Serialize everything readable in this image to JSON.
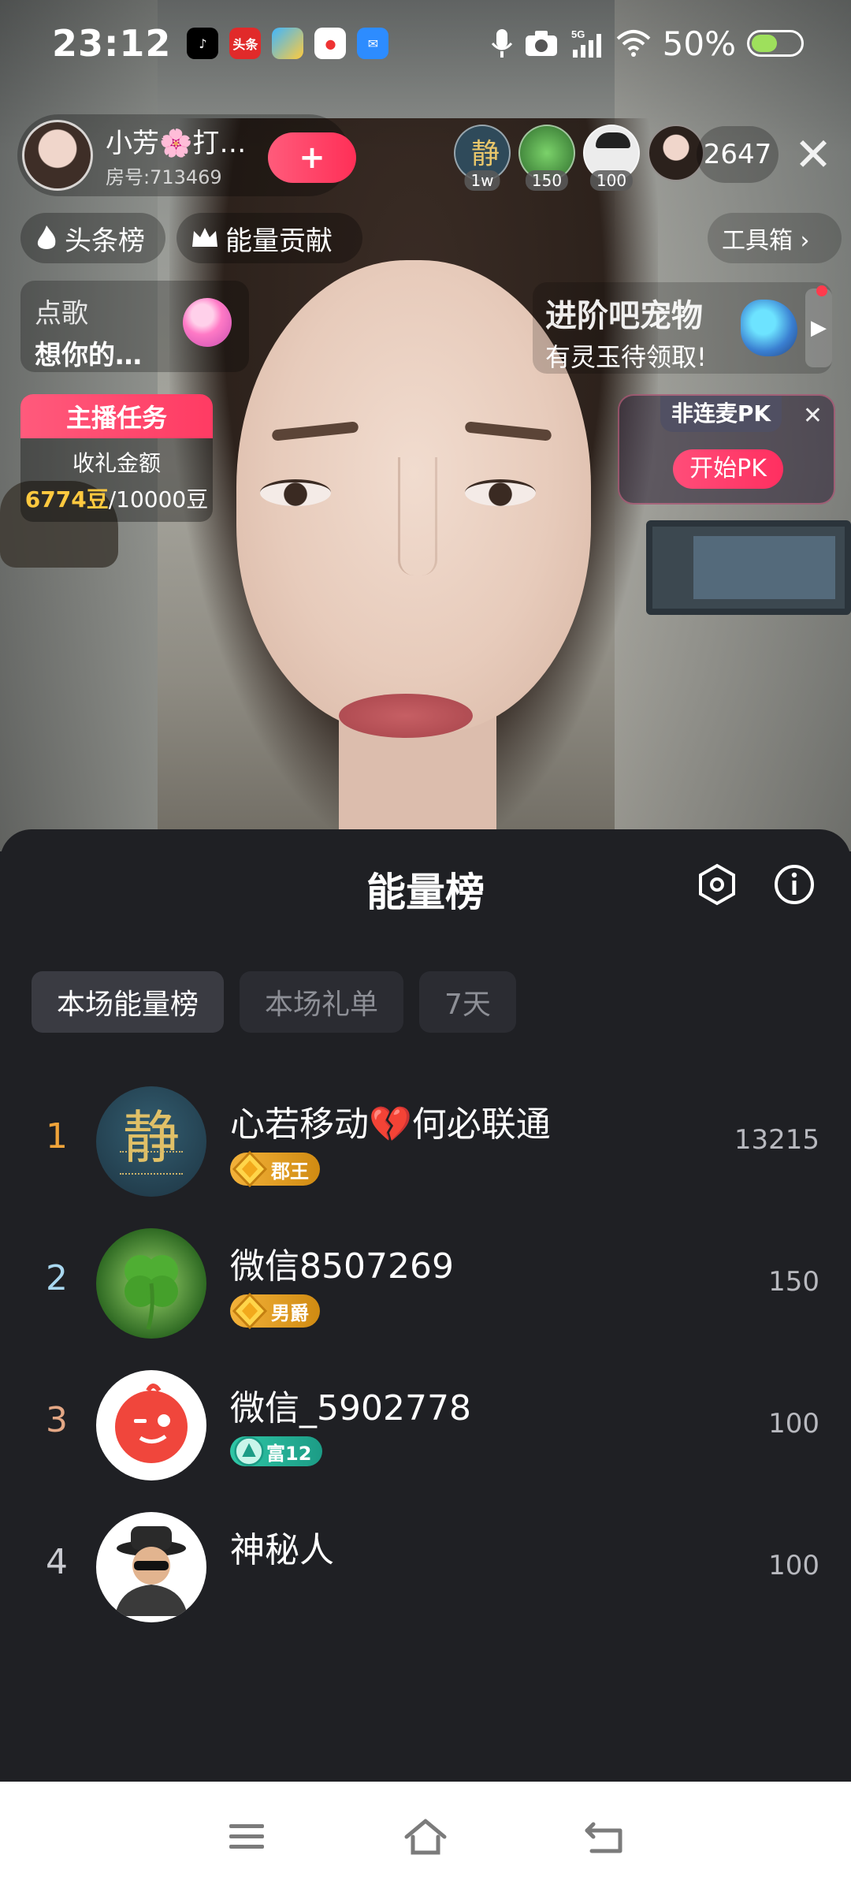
{
  "status_bar": {
    "time": "23:12",
    "network": "5G",
    "battery": "50%",
    "battery_level": 0.5,
    "app_icons": [
      "tiktok-icon",
      "toutiao-icon",
      "store-icon",
      "map-icon",
      "mail-icon"
    ],
    "app_icon_labels": {
      "toutiao": "头条"
    }
  },
  "live": {
    "host_name": "小芳🌸打…",
    "room_id": "房号:713469",
    "follow_symbol": "+",
    "viewers": [
      {
        "badge": "1w",
        "color": "#2f4a5a"
      },
      {
        "badge": "150",
        "color": "#2f6e2d"
      },
      {
        "badge": "100",
        "color": "#e9e9e9"
      },
      {
        "badge": "",
        "color": "#3a2c25"
      }
    ],
    "viewer_count": "2647",
    "close": "✕",
    "headline_tab": "头条榜",
    "energy_tab": "能量贡献",
    "toolbox": "工具箱 ›",
    "song": {
      "line1": "点歌",
      "line2": "想你的…"
    },
    "task": {
      "title": "主播任务",
      "label": "收礼金额",
      "current": "6774豆",
      "target": "/10000豆"
    },
    "pet": {
      "title": "进阶吧宠物",
      "subtitle": "有灵玉待领取!",
      "arrow": "▶"
    },
    "pk": {
      "tag": "非连麦PK",
      "close": "✕",
      "button": "开始PK"
    }
  },
  "sheet": {
    "title": "能量榜",
    "tabs": [
      {
        "label": "本场能量榜",
        "active": true
      },
      {
        "label": "本场礼单",
        "active": false
      },
      {
        "label": "7天",
        "active": false
      }
    ],
    "ranks": [
      {
        "rank": "1",
        "rank_color": "#f0a43a",
        "name": "心若移动💔何必联通",
        "badge": "郡王",
        "badge_color": "#e8a417",
        "score": "13215"
      },
      {
        "rank": "2",
        "rank_color": "#a9d8f0",
        "name": "微信8507269",
        "badge": "男爵",
        "badge_color": "#e8a417",
        "score": "150"
      },
      {
        "rank": "3",
        "rank_color": "#e3a785",
        "name": "微信_5902778",
        "badge": "富12",
        "badge_color": "#2bb39b",
        "score": "100"
      },
      {
        "rank": "4",
        "rank_color": "#c9cad0",
        "name": "神秘人",
        "badge": "",
        "badge_color": "",
        "score": "100"
      }
    ],
    "avatar_texts": {
      "rank1": "静"
    }
  },
  "navigation": {
    "menu": "menu-icon",
    "home": "home-icon",
    "back": "back-icon"
  }
}
